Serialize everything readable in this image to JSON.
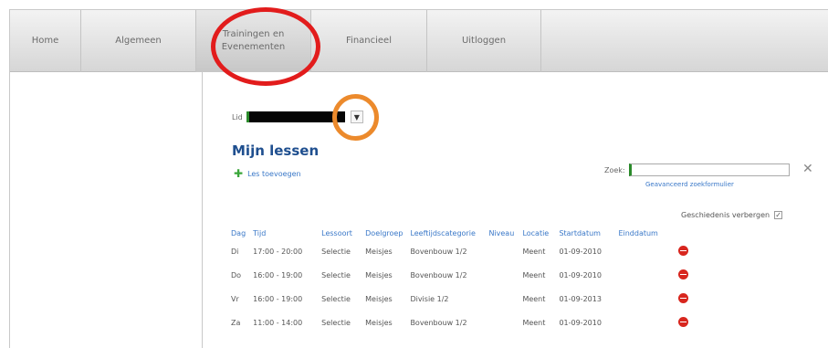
{
  "nav": {
    "items": [
      {
        "label": "Home"
      },
      {
        "label": "Algemeen"
      },
      {
        "label": "Trainingen en\nEvenementen",
        "active": true
      },
      {
        "label": "Financieel"
      },
      {
        "label": "Uitloggen"
      }
    ]
  },
  "list": {
    "label": "Lid"
  },
  "page": {
    "title": "Mijn lessen",
    "add_label": "Les toevoegen"
  },
  "search": {
    "label": "Zoek:",
    "value": "",
    "advanced_label": "Geavanceerd zoekformulier"
  },
  "history": {
    "label": "Geschiedenis verbergen",
    "checked": true
  },
  "table": {
    "headers": [
      "Dag",
      "Tijd",
      "Lessoort",
      "Doelgroep",
      "Leeftijdscategorie",
      "Niveau",
      "Locatie",
      "Startdatum",
      "Einddatum"
    ],
    "rows": [
      [
        "Di",
        "17:00 - 20:00",
        "Selectie",
        "Meisjes",
        "Bovenbouw 1/2",
        "",
        "Meent",
        "01-09-2010",
        ""
      ],
      [
        "Do",
        "16:00 - 19:00",
        "Selectie",
        "Meisjes",
        "Bovenbouw 1/2",
        "",
        "Meent",
        "01-09-2010",
        ""
      ],
      [
        "Vr",
        "16:00 - 19:00",
        "Selectie",
        "Meisjes",
        "Divisie 1/2",
        "",
        "Meent",
        "01-09-2013",
        ""
      ],
      [
        "Za",
        "11:00 - 14:00",
        "Selectie",
        "Meisjes",
        "Bovenbouw 1/2",
        "",
        "Meent",
        "01-09-2010",
        ""
      ]
    ]
  },
  "colors": {
    "accent": "#1f4f8f",
    "link": "#3a78c8",
    "annotation_red": "#e21c1c",
    "annotation_orange": "#ec8a2c",
    "delete": "#d8261e"
  }
}
